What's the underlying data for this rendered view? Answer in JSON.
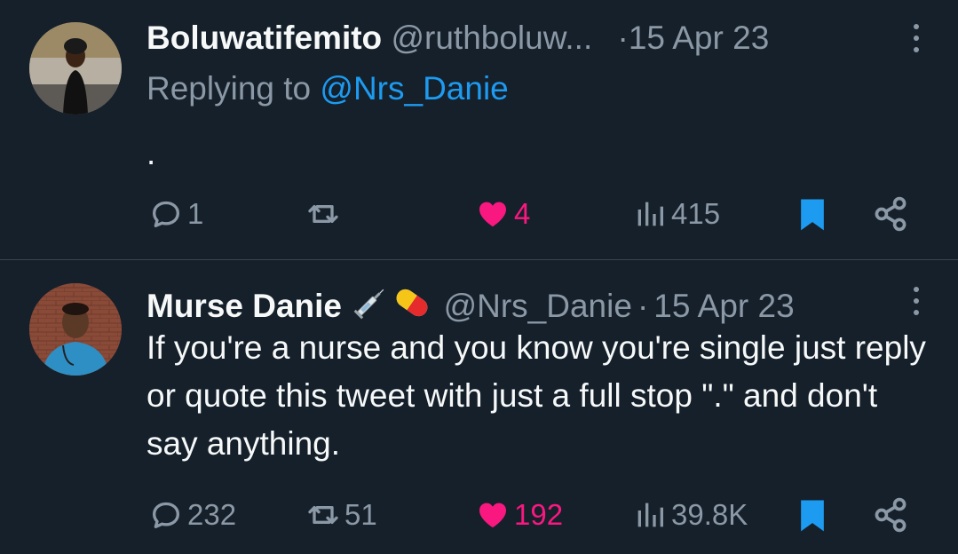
{
  "tweets": [
    {
      "display_name": "Boluwatifemito",
      "handle": "@ruthboluw...",
      "separator": "·",
      "date": "15 Apr 23",
      "replying_prefix": "Replying to",
      "replying_to": "@Nrs_Danie",
      "text": ".",
      "counts": {
        "replies": "1",
        "retweets": "",
        "likes": "4",
        "views": "415"
      },
      "liked": true,
      "bookmarked": true
    },
    {
      "display_name": "Murse Danie",
      "name_emojis": [
        "syringe-icon",
        "pill-icon"
      ],
      "handle": "@Nrs_Danie",
      "separator": "·",
      "date": "15 Apr 23",
      "text": "If you're a nurse and you know you're single just reply or quote this tweet with just a full stop \".\" and don't say anything.",
      "counts": {
        "replies": "232",
        "retweets": "51",
        "likes": "192",
        "views": "39.8K"
      },
      "liked": true,
      "bookmarked": true
    }
  ],
  "colors": {
    "background": "#15202b",
    "text_primary": "#f7f9f9",
    "text_secondary": "#8b98a5",
    "accent_blue": "#1d9bf0",
    "like_pink": "#f91880",
    "divider": "#38444d"
  }
}
